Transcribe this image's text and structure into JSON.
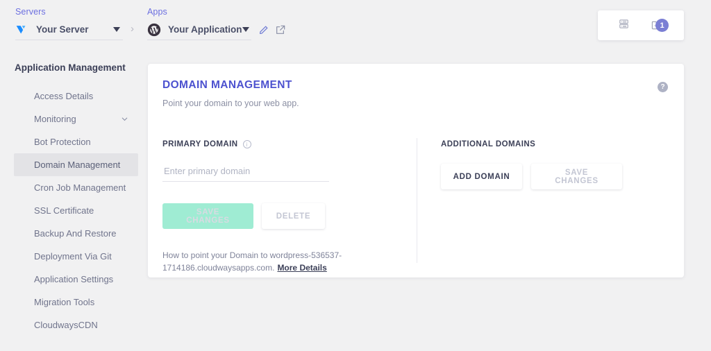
{
  "breadcrumb": {
    "servers": {
      "label": "Servers",
      "name": "Your Server",
      "icon": "vultr-logo-icon"
    },
    "separator": "›",
    "apps": {
      "label": "Apps",
      "name": "Your Application",
      "icon": "wordpress-logo-icon"
    },
    "actions": {
      "edit": "edit-pencil-icon",
      "open": "external-link-icon"
    }
  },
  "utility_card": {
    "list_icon": "server-list-icon",
    "folder_icon": "folder-icon",
    "badge_count": "1"
  },
  "sidebar": {
    "title": "Application Management",
    "items": [
      {
        "label": "Access Details",
        "active": false,
        "expandable": false
      },
      {
        "label": "Monitoring",
        "active": false,
        "expandable": true
      },
      {
        "label": "Bot Protection",
        "active": false,
        "expandable": false
      },
      {
        "label": "Domain Management",
        "active": true,
        "expandable": false
      },
      {
        "label": "Cron Job Management",
        "active": false,
        "expandable": false
      },
      {
        "label": "SSL Certificate",
        "active": false,
        "expandable": false
      },
      {
        "label": "Backup And Restore",
        "active": false,
        "expandable": false
      },
      {
        "label": "Deployment Via Git",
        "active": false,
        "expandable": false
      },
      {
        "label": "Application Settings",
        "active": false,
        "expandable": false
      },
      {
        "label": "Migration Tools",
        "active": false,
        "expandable": false
      },
      {
        "label": "CloudwaysCDN",
        "active": false,
        "expandable": false
      }
    ]
  },
  "card": {
    "title": "DOMAIN MANAGEMENT",
    "subtitle": "Point your domain to your web app.",
    "help_icon": "?",
    "primary": {
      "label": "PRIMARY DOMAIN",
      "info_icon": "i",
      "input_value": "",
      "input_placeholder": "Enter primary domain",
      "save_label": "SAVE CHANGES",
      "delete_label": "DELETE",
      "hint_text": "How to point your Domain to wordpress-536537-1714186.cloudwaysapps.com.",
      "hint_link": "More Details"
    },
    "additional": {
      "label": "ADDITIONAL DOMAINS",
      "add_label": "ADD DOMAIN",
      "save_label": "SAVE CHANGES"
    }
  },
  "colors": {
    "accent": "#4c51cf",
    "page_bg": "#f1f1f2",
    "save_green": "#9fecd3",
    "badge": "#7b7fd4",
    "breadcrumb_link": "#6c6fe0"
  }
}
